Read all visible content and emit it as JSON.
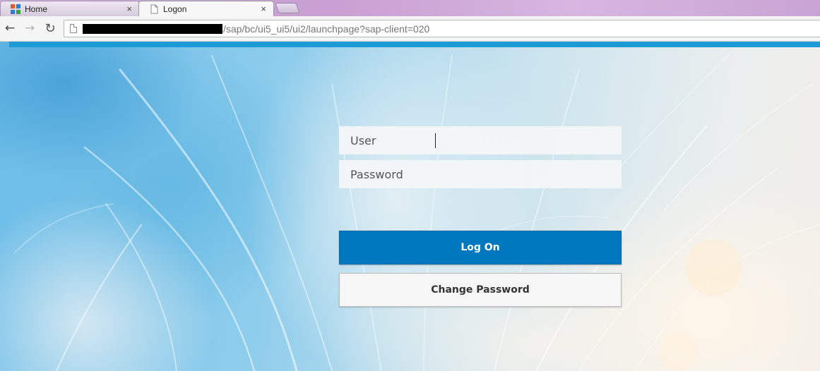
{
  "browser": {
    "tabs": [
      {
        "label": "Home",
        "active": false,
        "favicon": "sap-grid-icon",
        "close": "×"
      },
      {
        "label": "Logon",
        "active": true,
        "favicon": "page-icon",
        "close": "×"
      }
    ],
    "nav": {
      "back": "←",
      "forward": "→",
      "reload": "↻"
    },
    "address": {
      "url_visible": "/sap/bc/ui5_ui5/ui2/launchpage?sap-client=020",
      "prefix_redacted": true
    }
  },
  "logon": {
    "user_placeholder": "User",
    "password_placeholder": "Password",
    "logon_label": "Log On",
    "change_password_label": "Change Password"
  },
  "colors": {
    "accent_bar": "#1c9bd6",
    "logon_button": "#0078c0",
    "change_button": "#f6f6f6"
  }
}
